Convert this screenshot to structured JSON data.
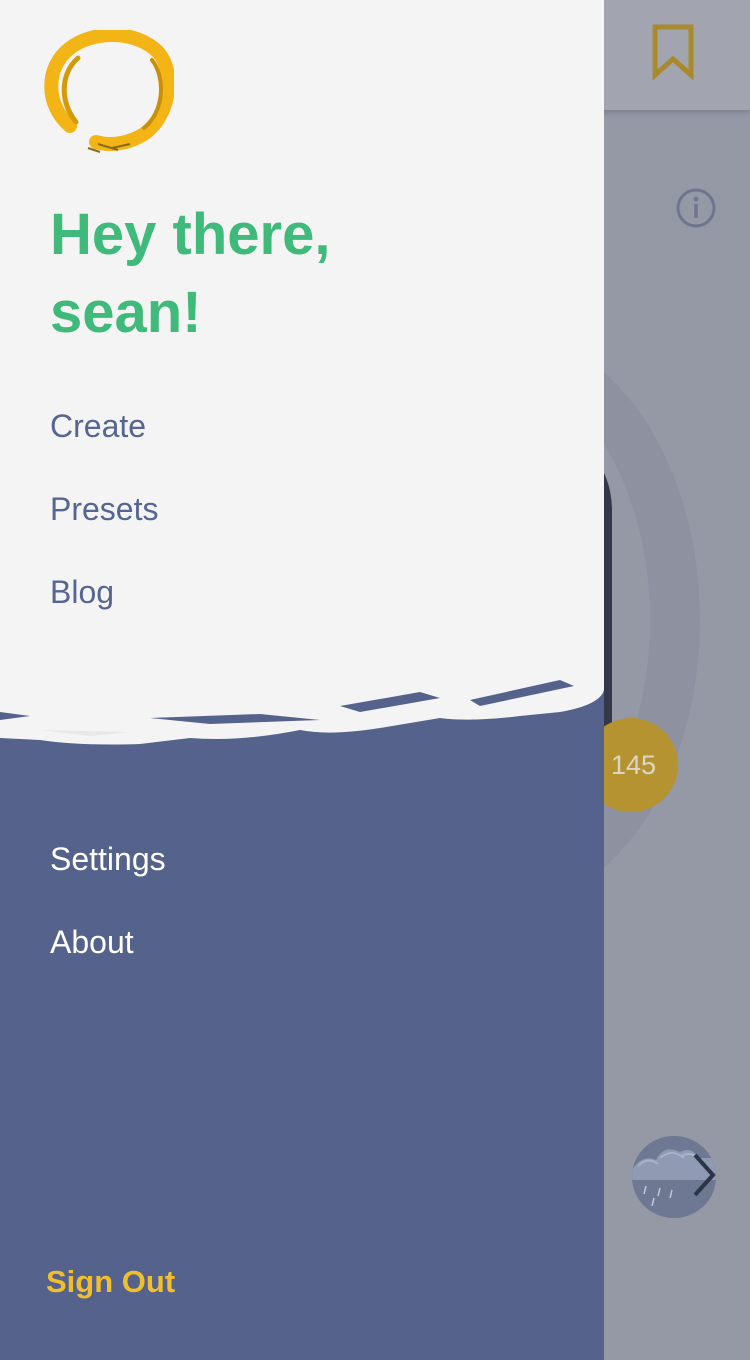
{
  "background": {
    "bookmark_icon": "bookmark-icon",
    "info_icon": "info-icon",
    "count_badge": "145",
    "next_icon": "chevron-right-icon",
    "thumbnail_icon": "rain-cloud-thumbnail"
  },
  "drawer": {
    "logo_icon": "brush-circle-logo",
    "greeting_line1": "Hey there,",
    "greeting_line2": "sean!",
    "primary_menu": [
      {
        "label": "Create"
      },
      {
        "label": "Presets"
      },
      {
        "label": "Blog"
      }
    ],
    "secondary_menu": [
      {
        "label": "Settings"
      },
      {
        "label": "About"
      }
    ],
    "sign_out": "Sign Out"
  },
  "colors": {
    "greeting": "#3fba7a",
    "drawer_bottom": "#55628b",
    "drawer_top": "#f4f4f4",
    "sign_out": "#f2bf2c",
    "accent_badge": "#b59331"
  }
}
